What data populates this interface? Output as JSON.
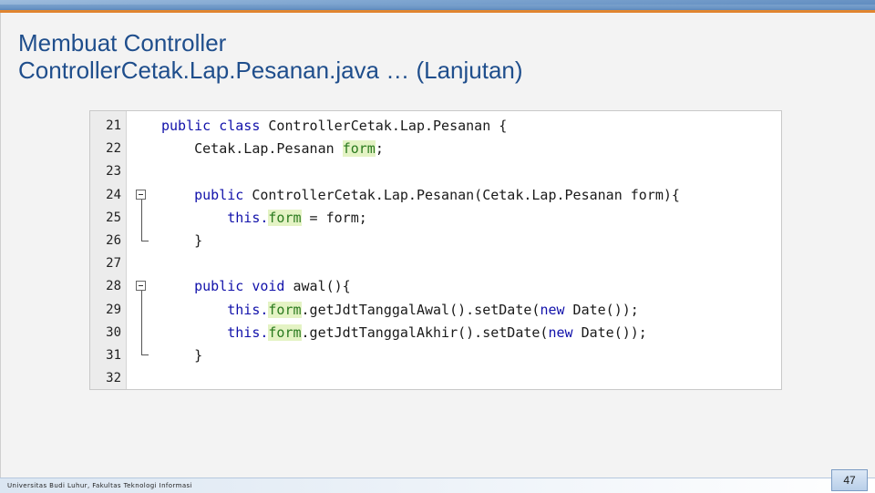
{
  "slide": {
    "title_line1": "Membuat Controller",
    "title_line2": "ControllerCetak.Lap.Pesanan.java … (Lanjutan)"
  },
  "code": {
    "lines": [
      {
        "number": "21",
        "segments": [
          {
            "t": "public class ",
            "s": "kw"
          },
          {
            "t": "ControllerCetak.Lap.Pesanan {",
            "s": ""
          }
        ]
      },
      {
        "number": "22",
        "segments": [
          {
            "t": "    Cetak.Lap.Pesanan ",
            "s": ""
          },
          {
            "t": "form",
            "s": "hl"
          },
          {
            "t": ";",
            "s": ""
          }
        ]
      },
      {
        "number": "23",
        "segments": []
      },
      {
        "number": "24",
        "segments": [
          {
            "t": "    public ",
            "s": "kw"
          },
          {
            "t": "ControllerCetak.Lap.Pesanan(Cetak.Lap.Pesanan form){",
            "s": ""
          }
        ]
      },
      {
        "number": "25",
        "segments": [
          {
            "t": "        this.",
            "s": "kw"
          },
          {
            "t": "form",
            "s": "hl"
          },
          {
            "t": " = form;",
            "s": ""
          }
        ]
      },
      {
        "number": "26",
        "segments": [
          {
            "t": "    }",
            "s": ""
          }
        ]
      },
      {
        "number": "27",
        "segments": []
      },
      {
        "number": "28",
        "segments": [
          {
            "t": "    public void ",
            "s": "kw"
          },
          {
            "t": "awal(){",
            "s": ""
          }
        ]
      },
      {
        "number": "29",
        "segments": [
          {
            "t": "        this.",
            "s": "kw"
          },
          {
            "t": "form",
            "s": "hl"
          },
          {
            "t": ".getJdtTanggalAwal().setDate(",
            "s": ""
          },
          {
            "t": "new",
            "s": "kw"
          },
          {
            "t": " Date());",
            "s": ""
          }
        ]
      },
      {
        "number": "30",
        "segments": [
          {
            "t": "        this.",
            "s": "kw"
          },
          {
            "t": "form",
            "s": "hl"
          },
          {
            "t": ".getJdtTanggalAkhir().setDate(",
            "s": ""
          },
          {
            "t": "new",
            "s": "kw"
          },
          {
            "t": " Date());",
            "s": ""
          }
        ]
      },
      {
        "number": "31",
        "segments": [
          {
            "t": "    }",
            "s": ""
          }
        ]
      },
      {
        "number": "32",
        "segments": []
      }
    ]
  },
  "footer": {
    "institution": "Universitas Budi Luhur, Fakultas Teknologi Informasi",
    "page_number": "47"
  },
  "colors": {
    "title": "#1f4e8c",
    "keyword": "#1111aa",
    "field_highlight_bg": "#e4f3c4",
    "field_highlight_fg": "#2a7a1e",
    "accent_orange": "#e07f2a"
  },
  "icons": {
    "fold_toggle": "collapse-minus-icon"
  }
}
